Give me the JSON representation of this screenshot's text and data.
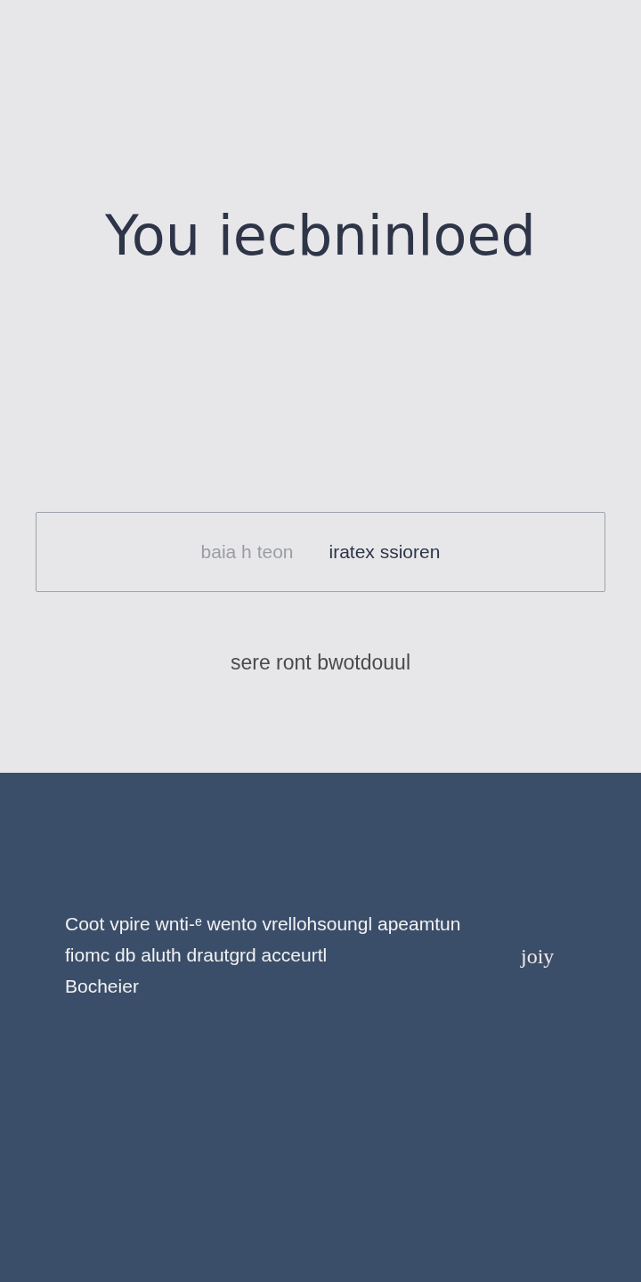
{
  "heading": "You iecbninloed",
  "message_box": {
    "parts": [
      {
        "text": "baia h teon",
        "faded": true
      },
      {
        "text": "iratex ssioren",
        "faded": false
      }
    ]
  },
  "link": "sere ront bwotdouul",
  "footer": {
    "lines": [
      "Coot vpire wnti-ᵉ wento vrellohsoungl apeamtun",
      "fiomc db aluth drautgrd acceurtl",
      "Bocheier"
    ],
    "mark": "joiy"
  }
}
